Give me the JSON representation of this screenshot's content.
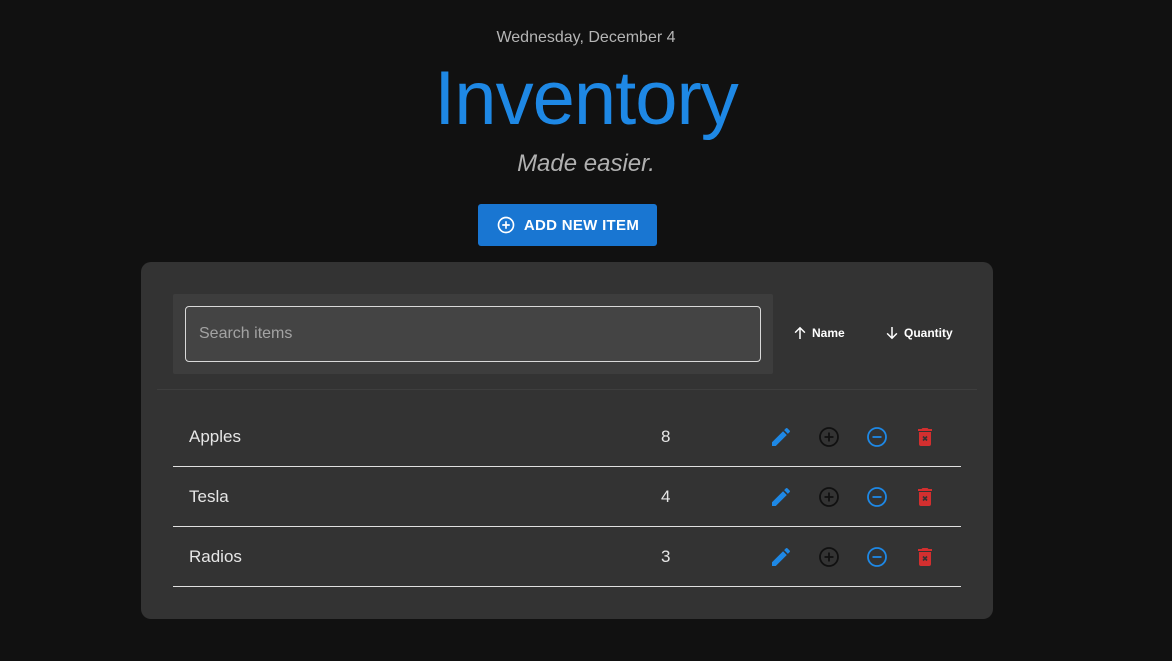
{
  "header": {
    "date": "Wednesday, December 4",
    "title": "Inventory",
    "subtitle": "Made easier."
  },
  "add_button": {
    "label": "ADD NEW ITEM",
    "icon": "add-circle-icon"
  },
  "search": {
    "placeholder": "Search items",
    "value": ""
  },
  "sort": {
    "name_label": "Name",
    "name_icon": "arrow-up-icon",
    "quantity_label": "Quantity",
    "quantity_icon": "arrow-down-icon"
  },
  "items": [
    {
      "name": "Apples",
      "quantity": "8"
    },
    {
      "name": "Tesla",
      "quantity": "4"
    },
    {
      "name": "Radios",
      "quantity": "3"
    }
  ],
  "actions": {
    "edit_icon": "pencil-icon",
    "increment_icon": "plus-circle-icon",
    "decrement_icon": "minus-circle-icon",
    "delete_icon": "trash-icon"
  },
  "colors": {
    "background": "#111111",
    "card": "#333333",
    "accent": "#1e88e5",
    "button": "#1976d2",
    "danger": "#d32f2f",
    "increment": "#111111"
  }
}
